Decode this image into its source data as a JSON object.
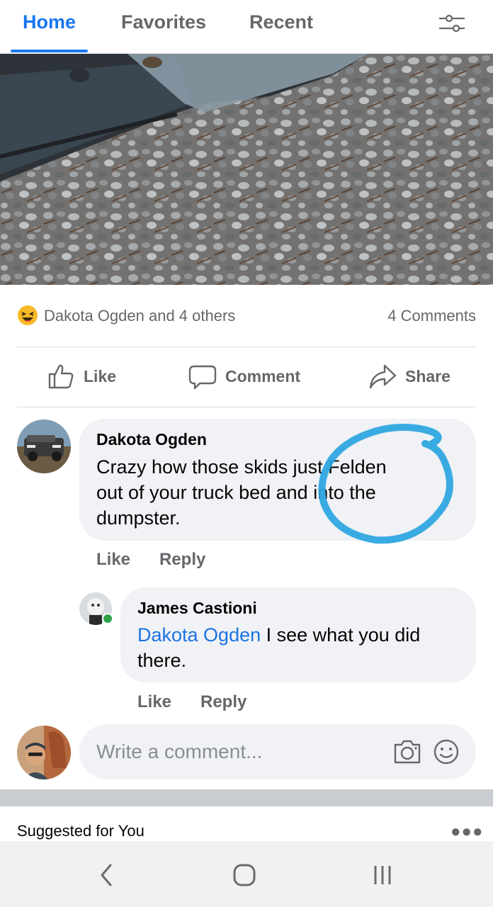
{
  "tabs": {
    "home": "Home",
    "favorites": "Favorites",
    "recent": "Recent",
    "accent_color": "#1877f2"
  },
  "post": {
    "reactions_text": "Dakota Ogden and 4 others",
    "reaction_icon": "laughing-emoji-icon",
    "comments_count": "4 Comments",
    "actions": {
      "like": "Like",
      "comment": "Comment",
      "share": "Share"
    }
  },
  "comments": [
    {
      "author": "Dakota Ogden",
      "text": "Crazy how those skids just Felden out of your truck bed and into the dumpster.",
      "line1": "Crazy how those skids just Felden",
      "line2": "out of your truck bed and into the",
      "line3": "dumpster.",
      "like": "Like",
      "reply": "Reply",
      "annotation": "blue-hand-drawn-circle"
    },
    {
      "author": "James Castioni",
      "mention": "Dakota Ogden",
      "text_after_mention": " I see what you did",
      "line2": "there.",
      "like": "Like",
      "reply": "Reply",
      "online": true
    }
  ],
  "composer": {
    "placeholder": "Write a comment..."
  },
  "suggested": {
    "title": "Suggested for You"
  }
}
